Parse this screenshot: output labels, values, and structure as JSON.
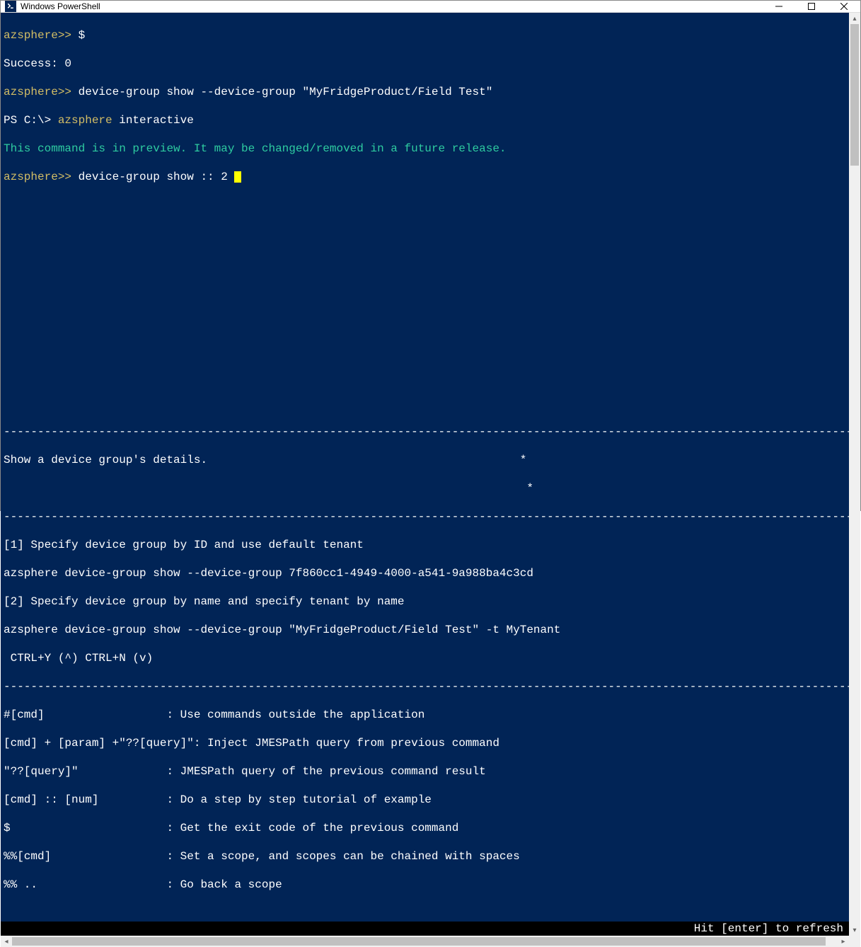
{
  "window": {
    "title": "Windows PowerShell"
  },
  "terminal": {
    "lines": {
      "l1_prompt": "azsphere>>",
      "l1_cmd": " $",
      "l2": "Success: 0",
      "l3_prompt": "azsphere>>",
      "l3_cmd": " device-group show --device-group \"MyFridgeProduct/Field Test\"",
      "l4_prefix": "PS C:\\> ",
      "l4_yellow1": "azsphere",
      "l4_white": " interactive",
      "l5": "This command is in preview. It may be changed/removed in a future release.",
      "l6_prompt": "azsphere>>",
      "l6_cmd": " device-group show :: 2 ",
      "dash": "--------------------------------------------------------------------------------------------------------------------------------------------------",
      "desc_left": "Show a device group's details.",
      "star": "*",
      "ex1": "[1] Specify device group by ID and use default tenant",
      "ex1cmd": "azsphere device-group show --device-group 7f860cc1-4949-4000-a541-9a988ba4c3cd",
      "ex2": "[2] Specify device group by name and specify tenant by name",
      "ex2cmd": "azsphere device-group show --device-group \"MyFridgeProduct/Field Test\" -t MyTenant",
      "ctrl": " CTRL+Y (^) CTRL+N (v)",
      "h1_key": "#[cmd]                  ",
      "h1_val": ": Use commands outside the application",
      "h2_key": "[cmd] + [param] +\"??[query]\"",
      "h2_val": ": Inject JMESPath query from previous command",
      "h3_key": "\"??[query]\"             ",
      "h3_val": ": JMESPath query of the previous command result",
      "h4_key": "[cmd] :: [num]          ",
      "h4_val": ": Do a step by step tutorial of example",
      "h5_key": "$                       ",
      "h5_val": ": Get the exit code of the previous command",
      "h6_key": "%%[cmd]                 ",
      "h6_val": ": Set a scope, and scopes can be chained with spaces",
      "h7_key": "%% ..                   ",
      "h7_val": ": Go back a scope",
      "footer": "Hit [enter] to refresh"
    }
  }
}
